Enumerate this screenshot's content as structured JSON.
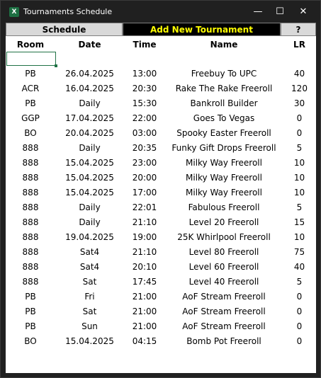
{
  "window": {
    "title": "Tournaments Schedule",
    "icon": "excel-icon",
    "controls": {
      "minimize": "—",
      "maximize": "☐",
      "close": "✕"
    }
  },
  "tabs": {
    "schedule": "Schedule",
    "add_new": "Add New Tournament",
    "help": "?"
  },
  "table": {
    "headers": {
      "room": "Room",
      "date": "Date",
      "time": "Time",
      "name": "Name",
      "lr": "LR"
    },
    "rows": [
      {
        "room": "PB",
        "date": "26.04.2025",
        "time": "13:00",
        "name": "Freebuy To UPC",
        "lr": "40"
      },
      {
        "room": "ACR",
        "date": "16.04.2025",
        "time": "20:30",
        "name": "Rake The Rake Freeroll",
        "lr": "120"
      },
      {
        "room": "PB",
        "date": "Daily",
        "time": "15:30",
        "name": "Bankroll Builder",
        "lr": "30"
      },
      {
        "room": "GGP",
        "date": "17.04.2025",
        "time": "22:00",
        "name": "Goes To Vegas",
        "lr": "0"
      },
      {
        "room": "BO",
        "date": "20.04.2025",
        "time": "03:00",
        "name": "Spooky Easter Freeroll",
        "lr": "0"
      },
      {
        "room": "888",
        "date": "Daily",
        "time": "20:35",
        "name": "Funky Gift Drops Freeroll",
        "lr": "5"
      },
      {
        "room": "888",
        "date": "15.04.2025",
        "time": "23:00",
        "name": "Milky Way Freeroll",
        "lr": "10"
      },
      {
        "room": "888",
        "date": "15.04.2025",
        "time": "20:00",
        "name": "Milky Way Freeroll",
        "lr": "10"
      },
      {
        "room": "888",
        "date": "15.04.2025",
        "time": "17:00",
        "name": "Milky Way Freeroll",
        "lr": "10"
      },
      {
        "room": "888",
        "date": "Daily",
        "time": "22:01",
        "name": "Fabulous Freeroll",
        "lr": "5"
      },
      {
        "room": "888",
        "date": "Daily",
        "time": "21:10",
        "name": "Level 20 Freeroll",
        "lr": "15"
      },
      {
        "room": "888",
        "date": "19.04.2025",
        "time": "19:00",
        "name": "25K Whirlpool Freeroll",
        "lr": "10"
      },
      {
        "room": "888",
        "date": "Sat4",
        "time": "21:10",
        "name": "Level 80 Freeroll",
        "lr": "75"
      },
      {
        "room": "888",
        "date": "Sat4",
        "time": "20:10",
        "name": "Level 60 Freeroll",
        "lr": "40"
      },
      {
        "room": "888",
        "date": "Sat",
        "time": "17:45",
        "name": "Level 40 Freeroll",
        "lr": "5"
      },
      {
        "room": "PB",
        "date": "Fri",
        "time": "21:00",
        "name": "AoF Stream Freeroll",
        "lr": "0"
      },
      {
        "room": "PB",
        "date": "Sat",
        "time": "21:00",
        "name": "AoF Stream Freeroll",
        "lr": "0"
      },
      {
        "room": "PB",
        "date": "Sun",
        "time": "21:00",
        "name": "AoF Stream Freeroll",
        "lr": "0"
      },
      {
        "room": "BO",
        "date": "15.04.2025",
        "time": "04:15",
        "name": "Bomb Pot Freeroll",
        "lr": "0"
      }
    ]
  },
  "colors": {
    "accent": "#217346",
    "add_tab_bg": "#000000",
    "add_tab_text": "#ffff00"
  }
}
